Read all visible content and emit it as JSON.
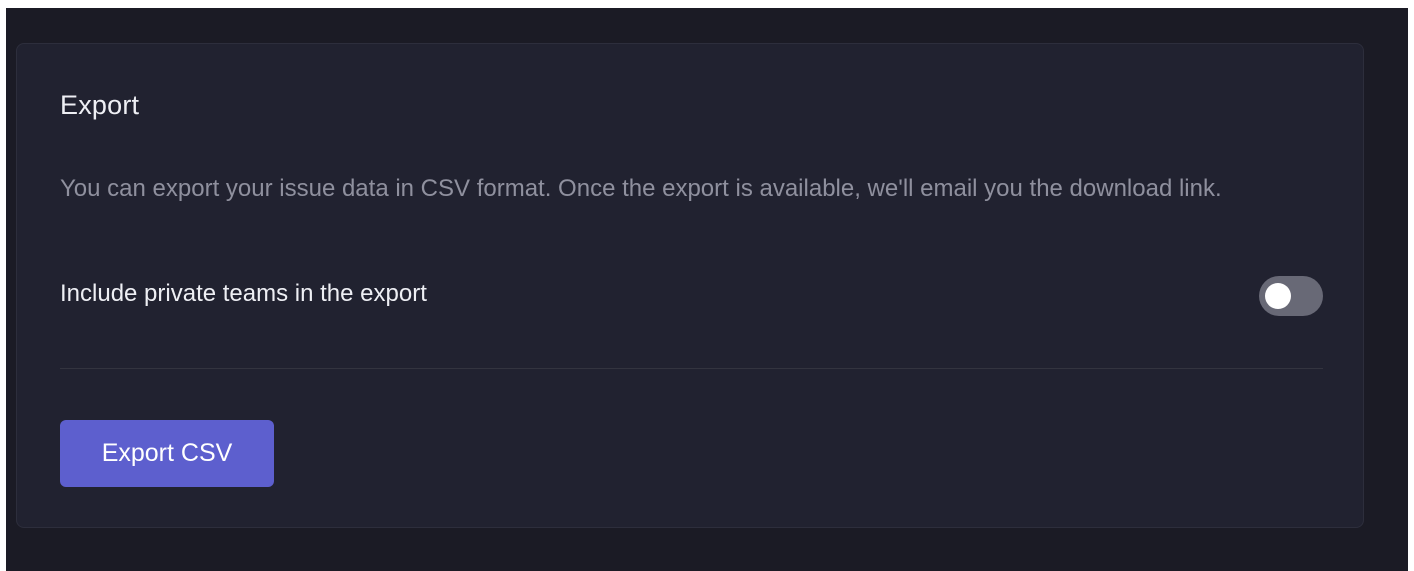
{
  "colors": {
    "app_background": "#1b1b25",
    "panel_background": "#212230",
    "accent": "#5d5fce",
    "toggle_off": "#686976"
  },
  "export_panel": {
    "title": "Export",
    "description": "You can export your issue data in CSV format. Once the export is available, we'll email you the download link.",
    "private_teams_setting": {
      "label": "Include private teams in the export",
      "enabled": false
    },
    "export_button_label": "Export CSV"
  }
}
